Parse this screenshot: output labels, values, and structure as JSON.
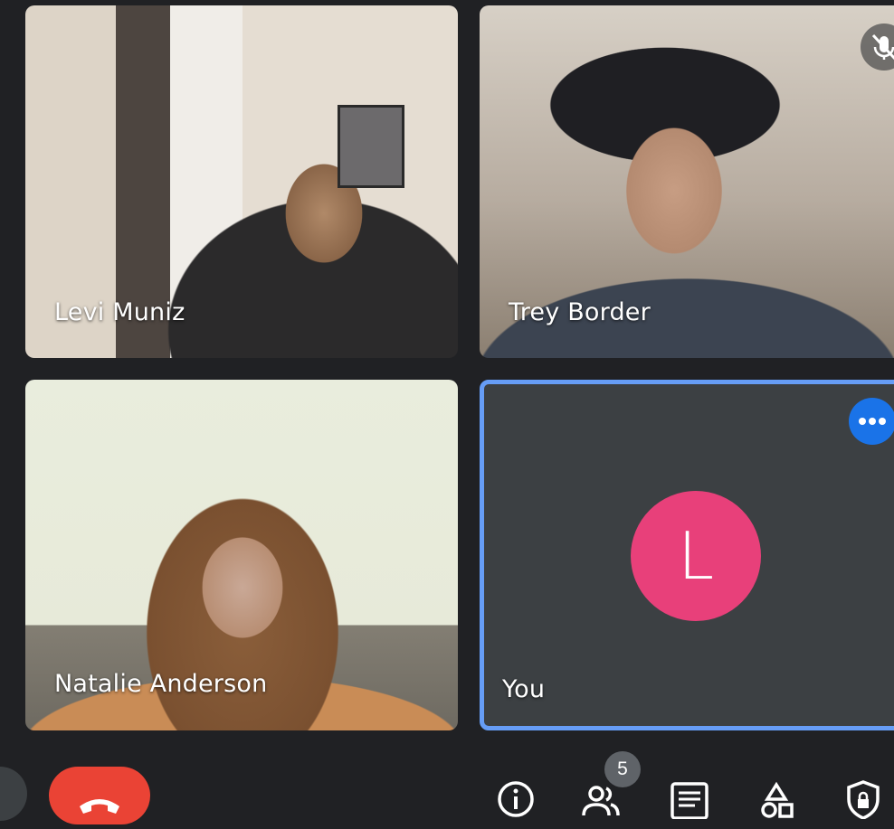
{
  "participants": [
    {
      "name": "Levi Muniz"
    },
    {
      "name": "Trey Border"
    },
    {
      "name": "Natalie Anderson"
    },
    {
      "name": "You",
      "avatar_letter": "L"
    }
  ],
  "controls": {
    "participant_count": "5"
  },
  "colors": {
    "background": "#202124",
    "end_call": "#ea4335",
    "avatar": "#e8407a",
    "self_tile_border": "#669df6",
    "more_button": "#1a73e8"
  }
}
